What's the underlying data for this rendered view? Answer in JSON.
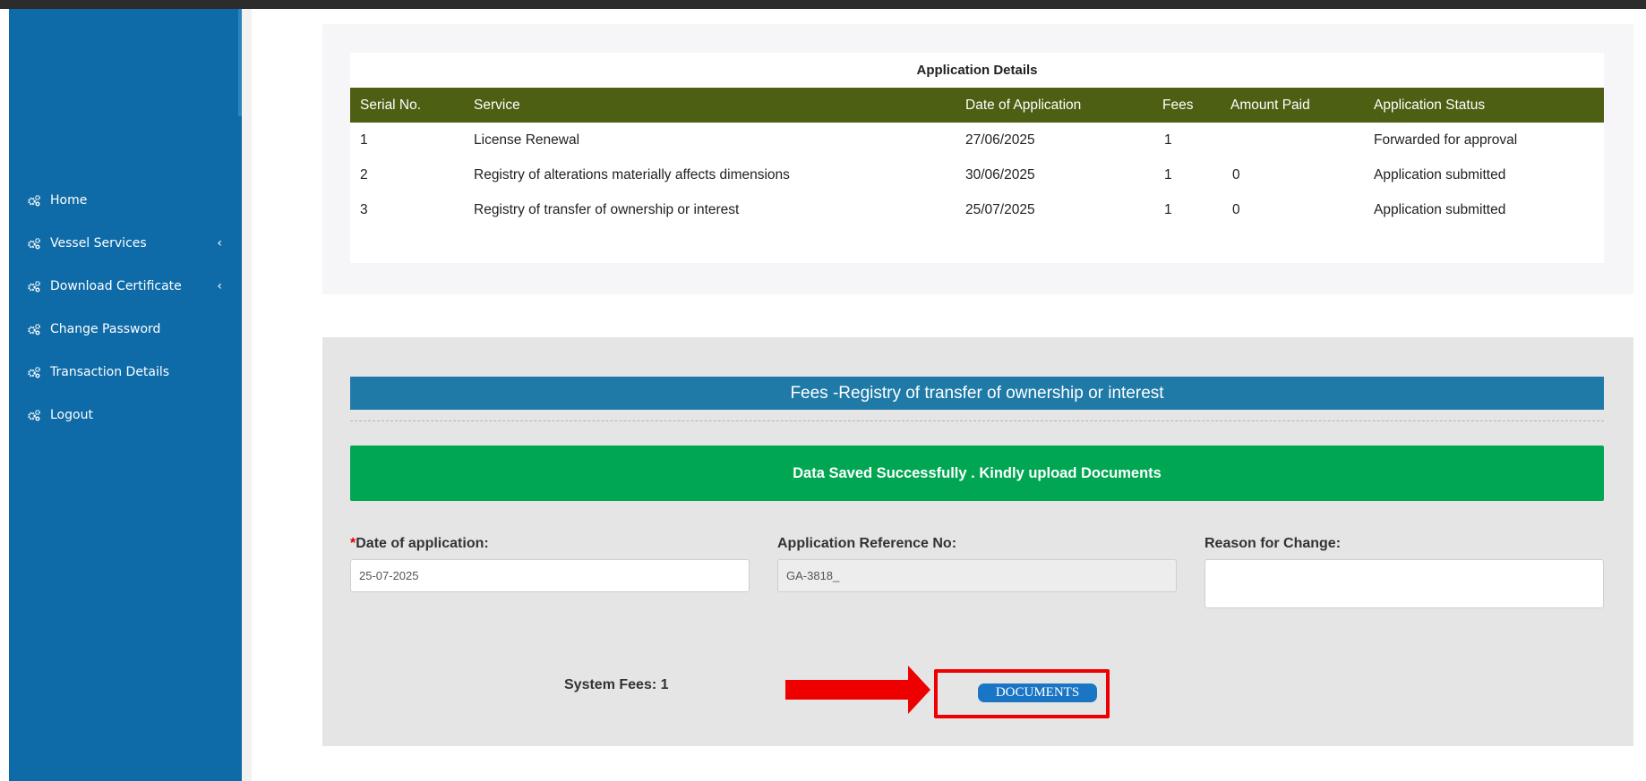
{
  "sidebar": {
    "items": [
      {
        "label": "Home",
        "icon": "cogs-icon",
        "has_submenu": false
      },
      {
        "label": "Vessel Services",
        "icon": "cogs-icon",
        "has_submenu": true
      },
      {
        "label": "Download Certificate",
        "icon": "cogs-icon",
        "has_submenu": true
      },
      {
        "label": "Change Password",
        "icon": "cogs-icon",
        "has_submenu": false
      },
      {
        "label": "Transaction Details",
        "icon": "cogs-icon",
        "has_submenu": false
      },
      {
        "label": "Logout",
        "icon": "cogs-icon",
        "has_submenu": false
      }
    ],
    "chevron": "‹"
  },
  "application_table": {
    "caption": "Application Details",
    "columns": [
      "Serial No.",
      "Service",
      "Date of Application",
      "Fees",
      "Amount Paid",
      "Application Status"
    ],
    "rows": [
      [
        "1",
        "License Renewal",
        "27/06/2025",
        "1",
        "",
        "Forwarded for approval"
      ],
      [
        "2",
        "Registry of alterations materially affects dimensions",
        "30/06/2025",
        "1",
        "0",
        "Application submitted"
      ],
      [
        "3",
        "Registry of transfer of ownership or interest",
        "25/07/2025",
        "1",
        "0",
        "Application submitted"
      ]
    ]
  },
  "fees_form": {
    "header": "Fees -Registry of transfer of ownership or interest",
    "alert": "Data Saved Successfully . Kindly upload Documents",
    "required_mark": "*",
    "date_label": "Date of application:",
    "date_value": "25-07-2025",
    "ref_label": "Application Reference No:",
    "ref_value": "GA-3818_",
    "reason_label": "Reason for Change:",
    "reason_value": "",
    "system_fees": "System Fees: 1",
    "documents_button": "DOCUMENTS"
  },
  "colors": {
    "sidebar": "#0e6ba8",
    "table_header": "#4d5f12",
    "fees_header": "#1f7aa8",
    "alert_success": "#00a652",
    "annotation_red": "#ee0000",
    "documents_button": "#1a76c4"
  }
}
